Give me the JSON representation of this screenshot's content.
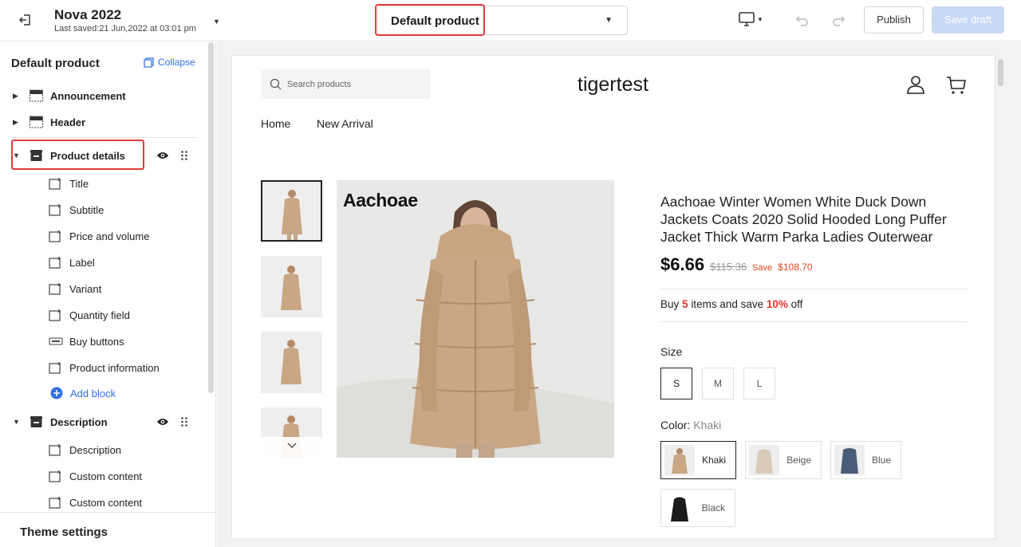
{
  "header": {
    "theme_name": "Nova 2022",
    "last_saved": "Last saved:21 Jun,2022 at 03:01 pm",
    "page_selector": "Default product",
    "publish": "Publish",
    "save_draft": "Save draft",
    "icons": [
      "exit-icon",
      "desktop-icon",
      "undo-icon",
      "redo-icon"
    ]
  },
  "sidebar": {
    "title": "Default product",
    "collapse": "Collapse",
    "sections": [
      {
        "label": "Announcement",
        "expanded": false
      },
      {
        "label": "Header",
        "expanded": false
      },
      {
        "label": "Product details",
        "expanded": true,
        "blocks": [
          {
            "label": "Title",
            "icon": "block-icon"
          },
          {
            "label": "Subtitle",
            "icon": "block-icon"
          },
          {
            "label": "Price and volume",
            "icon": "block-icon"
          },
          {
            "label": "Label",
            "icon": "block-icon"
          },
          {
            "label": "Variant",
            "icon": "block-icon"
          },
          {
            "label": "Quantity field",
            "icon": "block-icon"
          },
          {
            "label": "Buy buttons",
            "icon": "btn-icon"
          },
          {
            "label": "Product information",
            "icon": "block-icon"
          }
        ],
        "add_block": "Add block"
      },
      {
        "label": "Description",
        "expanded": true,
        "blocks": [
          {
            "label": "Description",
            "icon": "block-icon"
          },
          {
            "label": "Custom content",
            "icon": "block-icon"
          },
          {
            "label": "Custom content",
            "icon": "block-icon"
          }
        ]
      }
    ],
    "theme_settings": "Theme settings"
  },
  "preview": {
    "search_placeholder": "Search products",
    "store_name": "tigertest",
    "nav": [
      "Home",
      "New Arrival"
    ],
    "brand": "Aachoae",
    "product_title": "Aachoae Winter Women White Duck Down Jackets Coats 2020 Solid Hooded Long Puffer Jacket Thick Warm Parka Ladies Outerwear",
    "price": "$6.66",
    "compare_price": "$115.36",
    "save_label": "Save",
    "save_amount": "$108.70",
    "offer": {
      "pre": "Buy",
      "qty": "5",
      "mid": "items and save",
      "pct": "10%",
      "post": "off"
    },
    "size_label": "Size",
    "sizes": [
      "S",
      "M",
      "L"
    ],
    "selected_size": "S",
    "color_label": "Color:",
    "selected_color": "Khaki",
    "colors": [
      {
        "name": "Khaki",
        "hex": "#c9a684"
      },
      {
        "name": "Beige",
        "hex": "#d8ccb8"
      },
      {
        "name": "Blue",
        "hex": "#4a5d78"
      },
      {
        "name": "Black",
        "hex": "#1b1b1b"
      }
    ]
  },
  "colors": {
    "accent": "#2f6fe0",
    "highlight": "#e23b3b",
    "sale": "#d94a1c",
    "offer": "#e2352d"
  }
}
